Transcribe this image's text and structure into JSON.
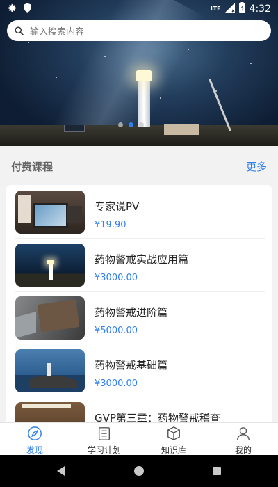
{
  "status_bar": {
    "time": "4:32",
    "network": "LTE",
    "icons": [
      "gear-icon",
      "shield-icon",
      "signal-icon",
      "battery-icon"
    ]
  },
  "search": {
    "placeholder": "输入搜索内容",
    "icon": "search-icon"
  },
  "banner": {
    "image": "lighthouse-night-sky",
    "page_count": 3,
    "active_page": 2
  },
  "section": {
    "title": "付费课程",
    "more_label": "更多"
  },
  "courses": [
    {
      "title": "专家说PV",
      "price": "¥19.90",
      "thumb": "laptop-workspace"
    },
    {
      "title": "药物警戒实战应用篇",
      "price": "¥3000.00",
      "thumb": "lighthouse-night"
    },
    {
      "title": "药物警戒进阶篇",
      "price": "¥5000.00",
      "thumb": "laptop-notebook"
    },
    {
      "title": "药物警戒基础篇",
      "price": "¥3000.00",
      "thumb": "lighthouse-coast"
    },
    {
      "title": "GVP第三章：药物警戒稽查",
      "price": "",
      "thumb": "library"
    }
  ],
  "bottom_nav": {
    "tabs": [
      {
        "label": "发现",
        "icon": "compass-icon",
        "active": true
      },
      {
        "label": "学习计划",
        "icon": "checklist-icon",
        "active": false
      },
      {
        "label": "知识库",
        "icon": "box-icon",
        "active": false
      },
      {
        "label": "我的",
        "icon": "user-icon",
        "active": false
      }
    ]
  },
  "colors": {
    "accent": "#2f80ed",
    "background": "#f2f2f2",
    "card": "#ffffff",
    "price": "#2f80ed"
  }
}
